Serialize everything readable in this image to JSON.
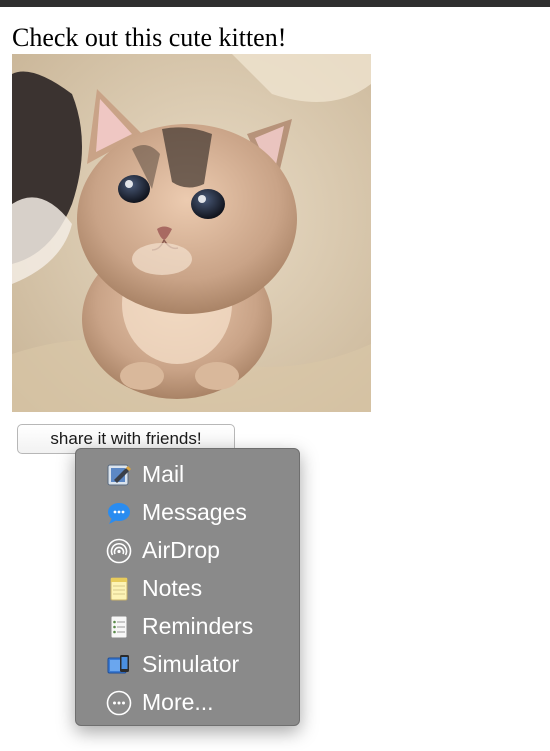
{
  "page": {
    "heading": "Check out this cute kitten!"
  },
  "photo": {
    "subject": "kitten",
    "icon": "kitten-photo"
  },
  "share_button": {
    "label": "share it with friends!"
  },
  "share_menu": {
    "items": [
      {
        "label": "Mail",
        "icon": "mail-icon"
      },
      {
        "label": "Messages",
        "icon": "messages-icon"
      },
      {
        "label": "AirDrop",
        "icon": "airdrop-icon"
      },
      {
        "label": "Notes",
        "icon": "notes-icon"
      },
      {
        "label": "Reminders",
        "icon": "reminders-icon"
      },
      {
        "label": "Simulator",
        "icon": "simulator-icon"
      },
      {
        "label": "More...",
        "icon": "more-icon"
      }
    ]
  },
  "colors": {
    "menu_background": "#8a8a8a",
    "menu_text": "#ffffff",
    "messages_blue": "#2a8cf0",
    "top_bar": "#2f2f2f"
  }
}
